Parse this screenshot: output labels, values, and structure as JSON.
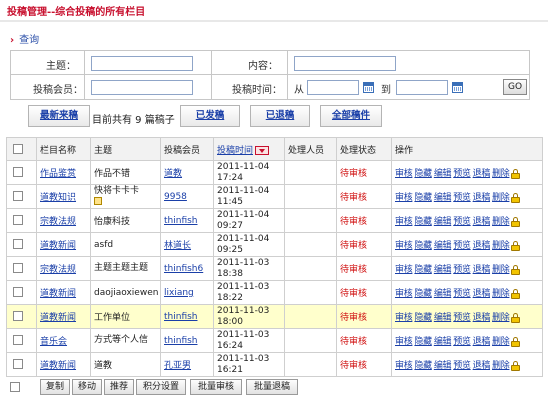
{
  "header": {
    "title": "投稿管理--综合投稿的所有栏目"
  },
  "breadcrumb": {
    "label": "查询"
  },
  "search": {
    "subject_label": "主题：",
    "content_label": "内容：",
    "member_label": "投稿会员：",
    "time_label": "投稿时间：",
    "from_label": "从",
    "to_label": "到",
    "go_label": "GO",
    "subject_value": "",
    "content_value": "",
    "member_value": "",
    "from_value": "",
    "to_value": ""
  },
  "toolbar": {
    "latest_label": "最新来稿",
    "info_text": "目前共有 9 篇稿子",
    "published_label": "已发稿",
    "returned_label": "已退稿",
    "all_label": "全部稿件"
  },
  "table": {
    "headers": {
      "column": "栏目名称",
      "subject": "主题",
      "member": "投稿会员",
      "time": "投稿时间",
      "handler": "处理人员",
      "status": "处理状态",
      "ops": "操作"
    },
    "ops_labels": [
      "审核",
      "隐藏",
      "编辑",
      "预览",
      "退稿",
      "删除"
    ],
    "rows": [
      {
        "column": "作品鉴赏",
        "subject": "作品不错",
        "member": "道教",
        "date": "2011-11-04",
        "time": "17:24",
        "handler": "",
        "status": "待审核"
      },
      {
        "column": "道教知识",
        "subject": "快将卡卡卡",
        "member": "9958",
        "date": "2011-11-04",
        "time": "11:45",
        "handler": "",
        "status": "待审核"
      },
      {
        "column": "宗教法规",
        "subject": "怡康科技",
        "member": "thinfish",
        "date": "2011-11-04",
        "time": "09:27",
        "handler": "",
        "status": "待审核"
      },
      {
        "column": "道教新闻",
        "subject": "asfd",
        "member": "林道长",
        "date": "2011-11-04",
        "time": "09:25",
        "handler": "",
        "status": "待审核"
      },
      {
        "column": "宗教法规",
        "subject": "主题主题主题",
        "member": "thinfish6",
        "date": "2011-11-03",
        "time": "18:38",
        "handler": "",
        "status": "待审核"
      },
      {
        "column": "道教新闻",
        "subject": "daojiaoxiewen",
        "member": "lixiang",
        "date": "2011-11-03",
        "time": "18:22",
        "handler": "",
        "status": "待审核"
      },
      {
        "column": "道教新闻",
        "subject": "工作单位",
        "member": "thinfish",
        "date": "2011-11-03",
        "time": "18:00",
        "handler": "",
        "status": "待审核"
      },
      {
        "column": "音乐会",
        "subject": "方式等个人信",
        "member": "thinfish",
        "date": "2011-11-03",
        "time": "16:24",
        "handler": "",
        "status": "待审核"
      },
      {
        "column": "道教新闻",
        "subject": "道教",
        "member": "孔亚男",
        "date": "2011-11-03",
        "time": "16:21",
        "handler": "",
        "status": "待审核"
      }
    ]
  },
  "bottom": {
    "copy_label": "复制",
    "move_label": "移动",
    "recommend_label": "推荐",
    "points_label": "积分设置",
    "batch_approve_label": "批量审核",
    "batch_return_label": "批量退稿"
  }
}
